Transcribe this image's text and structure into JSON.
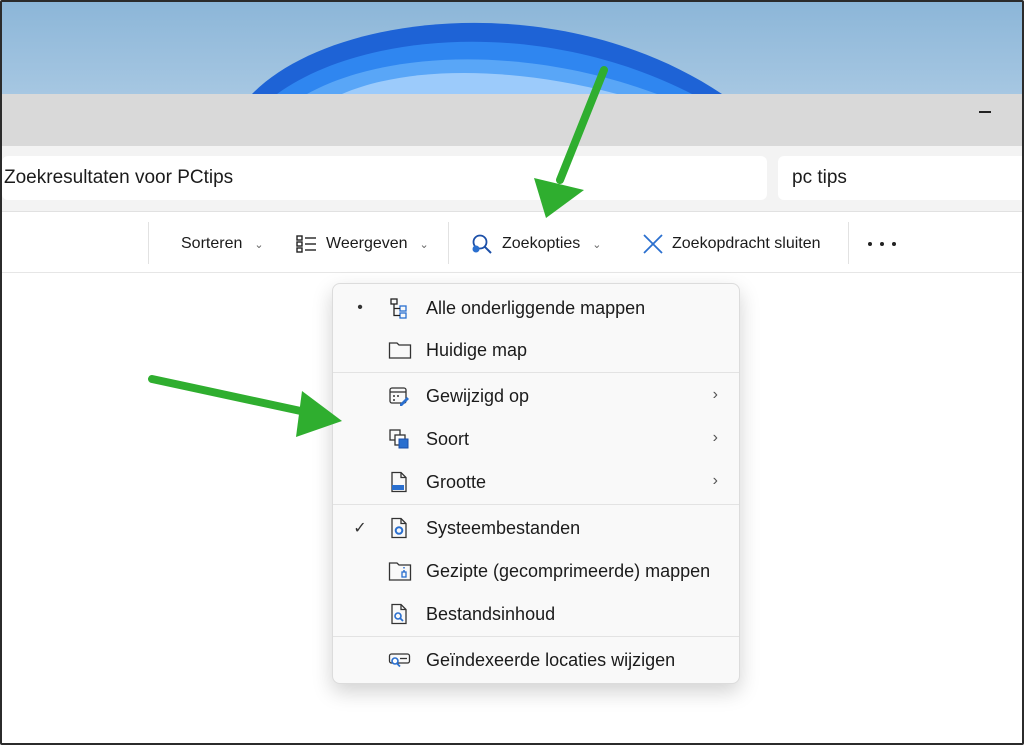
{
  "address": {
    "text": "Zoekresultaten voor PCtips"
  },
  "search": {
    "value": "pc tips"
  },
  "toolbar": {
    "sort_label": "Sorteren",
    "view_label": "Weergeven",
    "search_options_label": "Zoekopties",
    "close_search_label": "Zoekopdracht sluiten"
  },
  "menu": {
    "items": [
      {
        "label": "Alle onderliggende mappen",
        "icon": "subfolders-icon",
        "marker": "•"
      },
      {
        "label": "Huidige map",
        "icon": "folder-icon",
        "marker": ""
      },
      {
        "label": "Gewijzigd op",
        "icon": "calendar-edit-icon",
        "submenu": "›"
      },
      {
        "label": "Soort",
        "icon": "file-types-icon",
        "submenu": "›"
      },
      {
        "label": "Grootte",
        "icon": "file-size-icon",
        "submenu": "›"
      },
      {
        "label": "Systeembestanden",
        "icon": "system-file-icon",
        "marker": "✓"
      },
      {
        "label": "Gezipte (gecomprimeerde) mappen",
        "icon": "zip-folder-icon",
        "marker": ""
      },
      {
        "label": "Bestandsinhoud",
        "icon": "file-search-icon",
        "marker": ""
      },
      {
        "label": "Geïndexeerde locaties wijzigen",
        "icon": "index-search-icon",
        "marker": ""
      }
    ]
  },
  "colors": {
    "accent": "#2a6fcf",
    "annotation_arrow": "#2fae2f",
    "menu_bg": "#f9f9f9",
    "titlebar_bg": "#d9d9d9"
  }
}
